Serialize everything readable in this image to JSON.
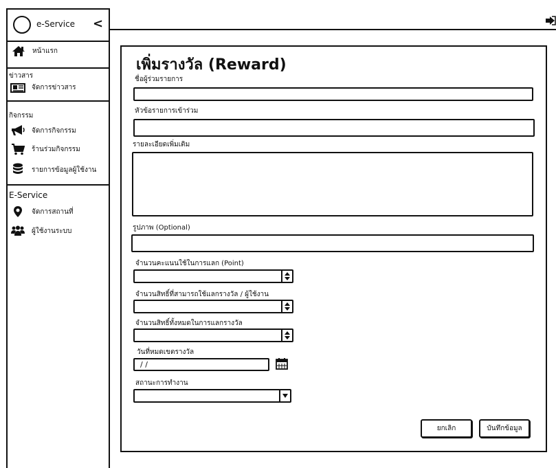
{
  "sidebar": {
    "brand": "e-Service",
    "collapse_glyph": "<",
    "home_label": "หน้าแรก",
    "news_section": "ข่าวสาร",
    "news_manage": "จัดการข่าวสาร",
    "activity_section": "กิจกรรม",
    "activity_manage": "จัดการกิจกรรม",
    "activity_shop": "ร้านร่วมกิจกรรม",
    "activity_users": "รายการข้อมูลผู้ใช้งาน",
    "eservice_section": "E-Service",
    "place_manage": "จัดการสถานที่",
    "system_users": "ผู้ใช้งานระบบ"
  },
  "form": {
    "title": "เพิ่มรางวัล (Reward)",
    "participant_label": "ชื่อผู้ร่วมรายการ",
    "participant_value": "",
    "topic_label": "หัวข้อรายการเข้าร่วม",
    "topic_value": "",
    "detail_label": "รายละเอียดเพิ่มเติม",
    "detail_value": "",
    "image_label": "รูปภาพ (Optional)",
    "image_value": "",
    "points_label": "จำนวนคะแนนใช้ในการแลก (Point)",
    "rights_per_user_label": "จำนวนสิทธิ์ที่สามารถใช้แลกรางวัล / ผู้ใช้งาน",
    "rights_total_label": "จำนวนสิทธิ์ทั้งหมดในการแลกรางวัล",
    "expire_label": "วันที่หมดเขตรางวัล",
    "expire_value": " /  /",
    "status_label": "สถานะการทำงาน",
    "status_value": "",
    "cancel_label": "ยกเลิก",
    "save_label": "บันทึกข้อมูล"
  }
}
